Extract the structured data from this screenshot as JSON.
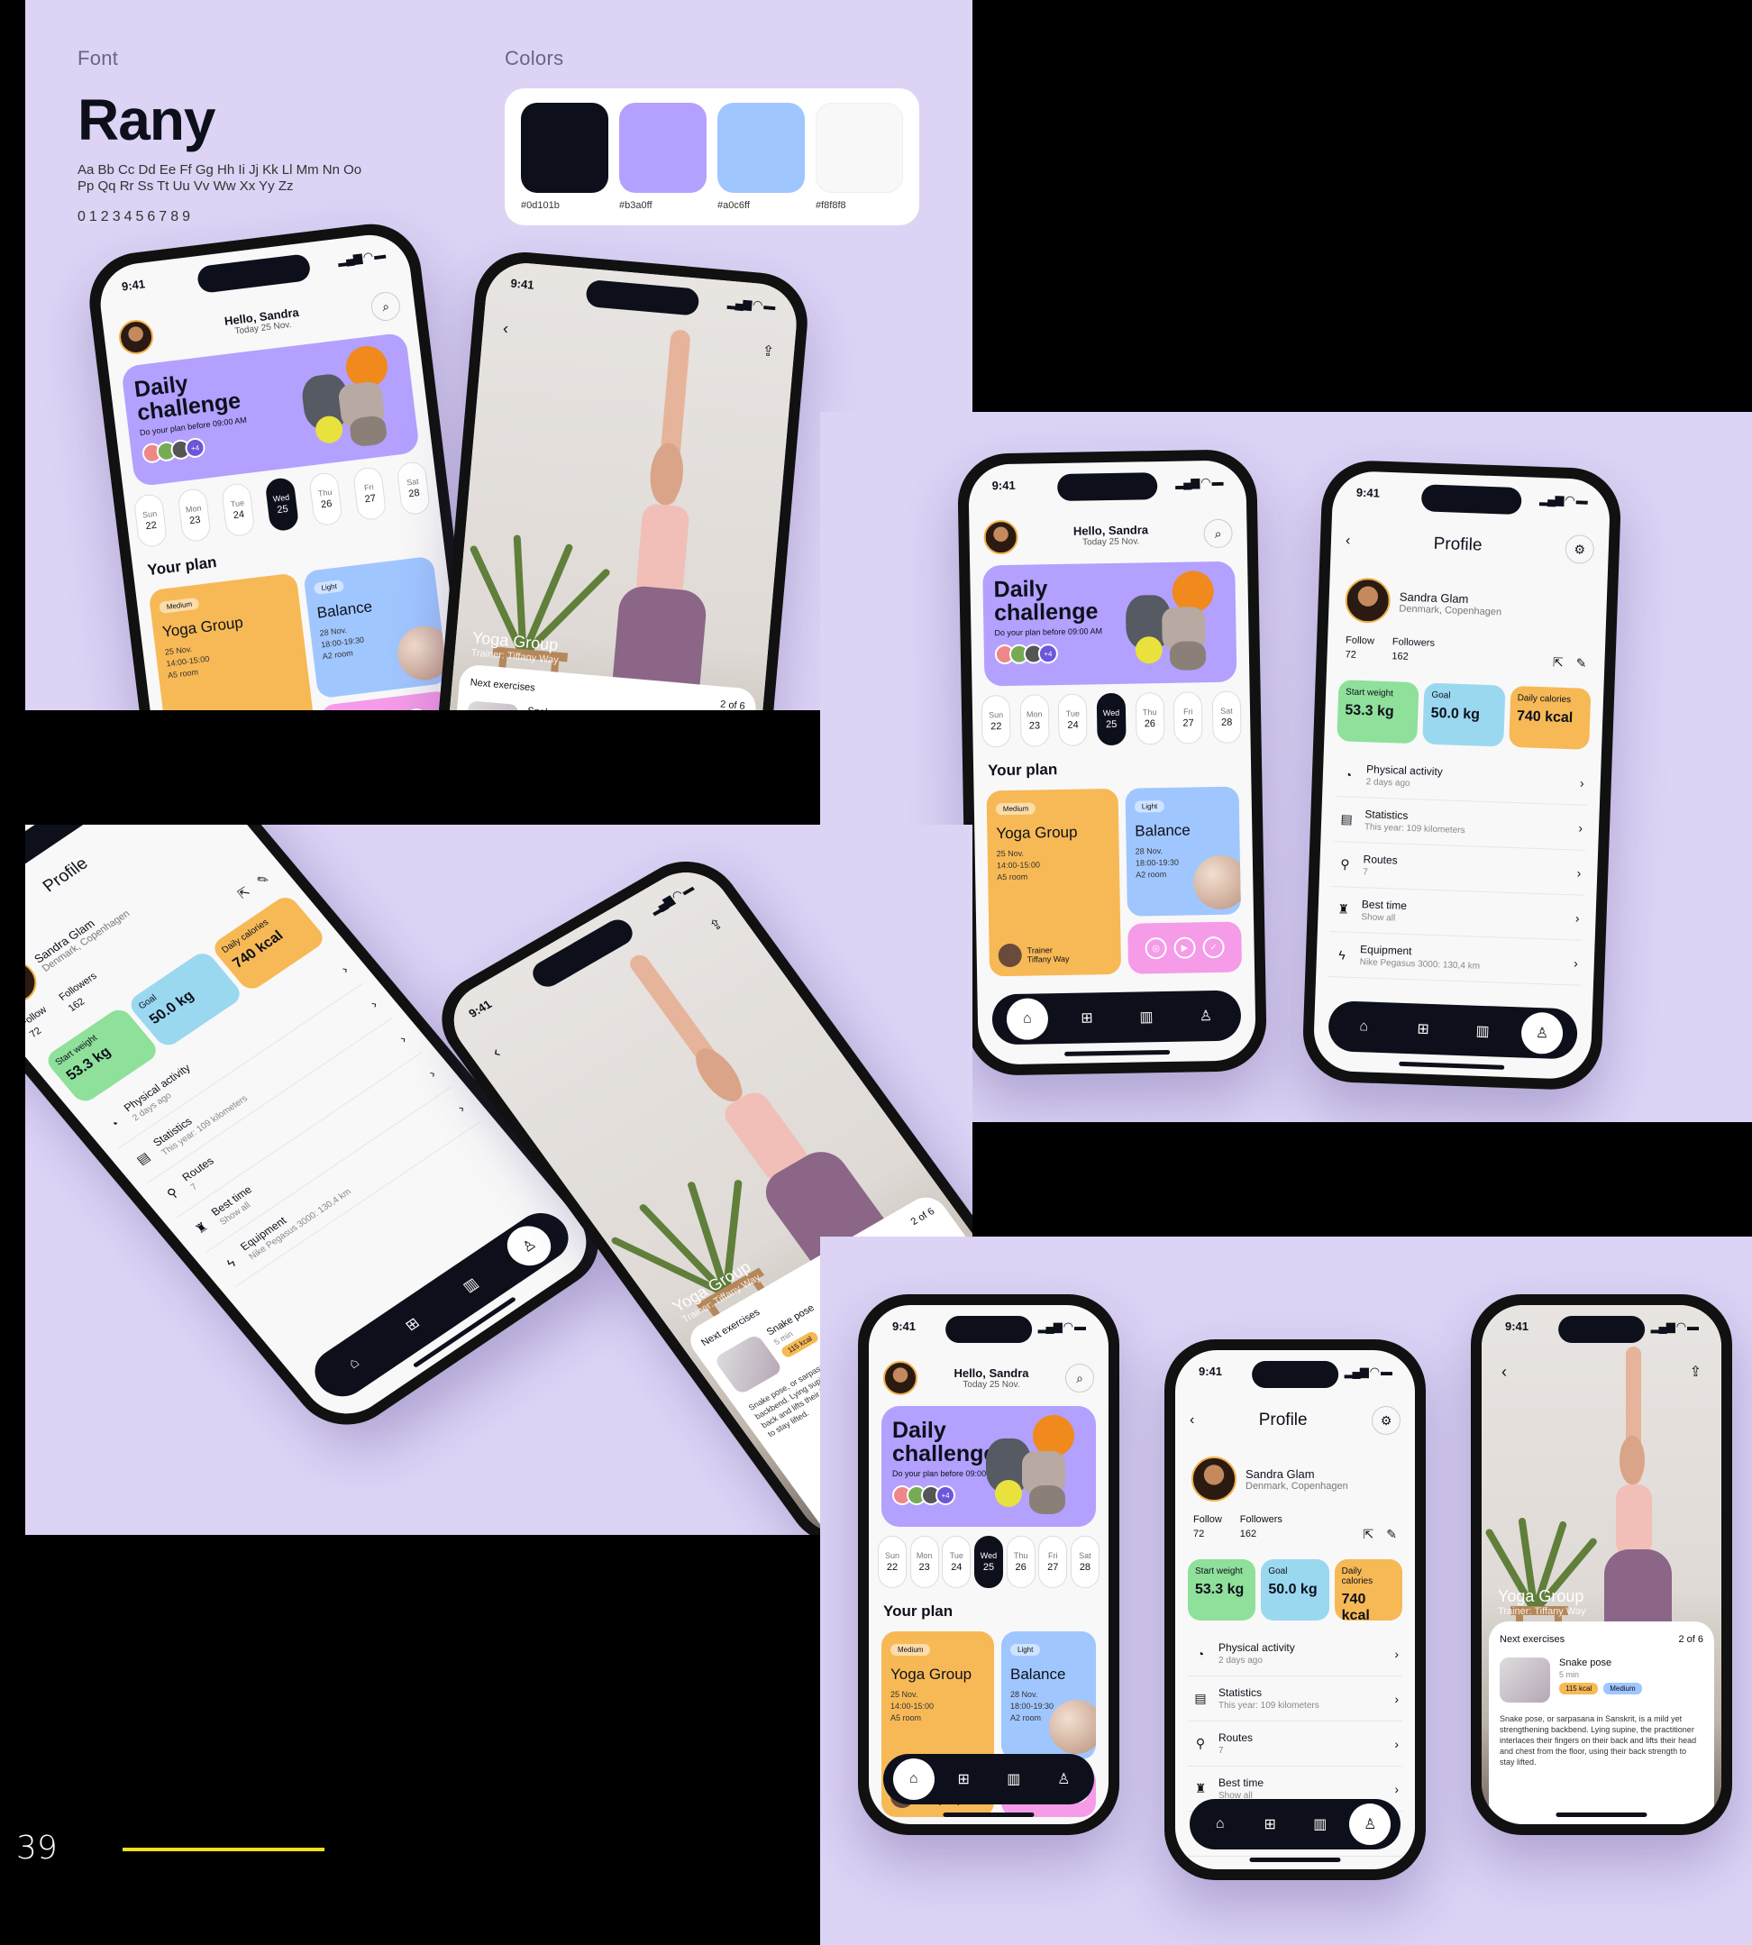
{
  "style_guide": {
    "font_label": "Font",
    "font_name": "Rany",
    "alphabet": "Aa Bb Cc Dd Ee Ff Gg Hh Ii Jj Kk Ll Mm Nn Oo Pp Qq Rr Ss Tt Uu Vv Ww Xx Yy Zz",
    "numbers": "0123456789",
    "colors_label": "Colors",
    "colors": [
      {
        "hex": "#0d101b",
        "label": "#0d101b"
      },
      {
        "hex": "#b3a0ff",
        "label": "#b3a0ff"
      },
      {
        "hex": "#a0c6ff",
        "label": "#a0c6ff"
      },
      {
        "hex": "#f8f8f8",
        "label": "#f8f8f8"
      }
    ]
  },
  "status": {
    "time": "9:41",
    "signal": "▂▄▆ ◠ ▬"
  },
  "home": {
    "greeting": "Hello, Sandra",
    "date": "Today 25 Nov.",
    "challenge_title": "Daily challenge",
    "challenge_sub": "Do your plan before 09:00 AM",
    "participants_more": "+4",
    "days": [
      {
        "name": "Sun",
        "num": "22"
      },
      {
        "name": "Mon",
        "num": "23"
      },
      {
        "name": "Tue",
        "num": "24"
      },
      {
        "name": "Wed",
        "num": "25"
      },
      {
        "name": "Thu",
        "num": "26"
      },
      {
        "name": "Fri",
        "num": "27"
      },
      {
        "name": "Sat",
        "num": "28"
      }
    ],
    "plan_title": "Your plan",
    "card1": {
      "level": "Medium",
      "title": "Yoga Group",
      "date": "25 Nov.",
      "time": "14:00-15:00",
      "room": "A5 room",
      "trainer_label": "Trainer",
      "trainer": "Tiffany Way"
    },
    "card2": {
      "level": "Light",
      "title": "Balance",
      "date": "28 Nov.",
      "time": "18:00-19:30",
      "room": "A2 room"
    }
  },
  "profile": {
    "title": "Profile",
    "name": "Sandra Glam",
    "location": "Denmark, Copenhagen",
    "follow_label": "Follow",
    "follow": "72",
    "followers_label": "Followers",
    "followers": "162",
    "stats": [
      {
        "label": "Start weight",
        "value": "53.3 kg",
        "color": "#8fe09a"
      },
      {
        "label": "Goal",
        "value": "50.0 kg",
        "color": "#9ad8f0"
      },
      {
        "label": "Daily calories",
        "value": "740 kcal",
        "color": "#f7b955"
      }
    ],
    "items": [
      {
        "icon": "◔",
        "title": "Physical activity",
        "sub": "2 days ago"
      },
      {
        "icon": "▤",
        "title": "Statistics",
        "sub": "This year: 109 kilometers"
      },
      {
        "icon": "⚲",
        "title": "Routes",
        "sub": "7"
      },
      {
        "icon": "♜",
        "title": "Best time",
        "sub": "Show all"
      },
      {
        "icon": "ϟ",
        "title": "Equipment",
        "sub": "Nike Pegasus 3000: 130,4 km"
      }
    ]
  },
  "yoga": {
    "title": "Yoga Group",
    "trainer": "Trainer: Tiffany Way",
    "next_label": "Next exercises",
    "count": "2 of 6",
    "exercise": "Snake pose",
    "duration": "5 min",
    "kcal": "115 kcal",
    "level": "Medium",
    "desc": "Snake pose, or sarpasana in Sanskrit, is a mild yet strengthening backbend. Lying supine, the practitioner interlaces their fingers on their back and lifts their head and chest from the floor, using their back strength to stay lifted."
  },
  "footer": {
    "page": "39"
  }
}
